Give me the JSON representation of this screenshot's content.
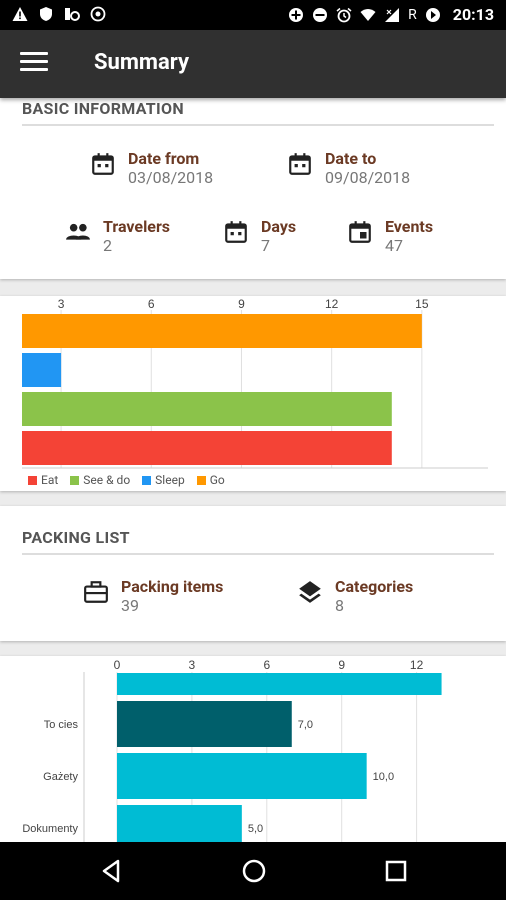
{
  "status_bar": {
    "time": "20:13",
    "r_label": "R"
  },
  "app_bar": {
    "title": "Summary"
  },
  "basic_info": {
    "title": "BASIC INFORMATION",
    "date_from": {
      "label": "Date from",
      "value": "03/08/2018"
    },
    "date_to": {
      "label": "Date to",
      "value": "09/08/2018"
    },
    "travelers": {
      "label": "Travelers",
      "value": "2"
    },
    "days": {
      "label": "Days",
      "value": "7"
    },
    "events": {
      "label": "Events",
      "value": "47"
    }
  },
  "events_chart": {
    "legend": [
      {
        "name": "Eat",
        "color": "#f44336"
      },
      {
        "name": "See & do",
        "color": "#8bc34a"
      },
      {
        "name": "Sleep",
        "color": "#2196f3"
      },
      {
        "name": "Go",
        "color": "#ff9800"
      }
    ]
  },
  "packing_list": {
    "title": "PACKING LIST",
    "items": {
      "label": "Packing items",
      "value": "39"
    },
    "categories": {
      "label": "Categories",
      "value": "8"
    }
  },
  "chart_data": [
    {
      "type": "bar",
      "orientation": "horizontal",
      "ticks": [
        3,
        6,
        9,
        12,
        15
      ],
      "xlim": [
        1.7,
        17.2
      ],
      "grid": true,
      "legend_position": "bottom-left",
      "series": [
        {
          "name": "Go",
          "value": 15,
          "color": "#ff9800"
        },
        {
          "name": "Sleep",
          "value": 3,
          "color": "#2196f3"
        },
        {
          "name": "See & do",
          "value": 14,
          "color": "#8bc34a"
        },
        {
          "name": "Eat",
          "value": 14,
          "color": "#f44336"
        }
      ]
    },
    {
      "type": "bar",
      "orientation": "horizontal",
      "ticks": [
        0,
        3,
        6,
        9,
        12
      ],
      "xlim": [
        0,
        14.9
      ],
      "grid": true,
      "bars": [
        {
          "category": "",
          "value": 13,
          "label": "",
          "color": "#00bcd4"
        },
        {
          "category": "To cies",
          "value": 7.0,
          "label": "7,0",
          "color": "#005f6b"
        },
        {
          "category": "Gażety",
          "value": 10.0,
          "label": "10,0",
          "color": "#00bcd4"
        },
        {
          "category": "Dokumenty",
          "value": 5.0,
          "label": "5,0",
          "color": "#00bcd4"
        }
      ]
    }
  ]
}
